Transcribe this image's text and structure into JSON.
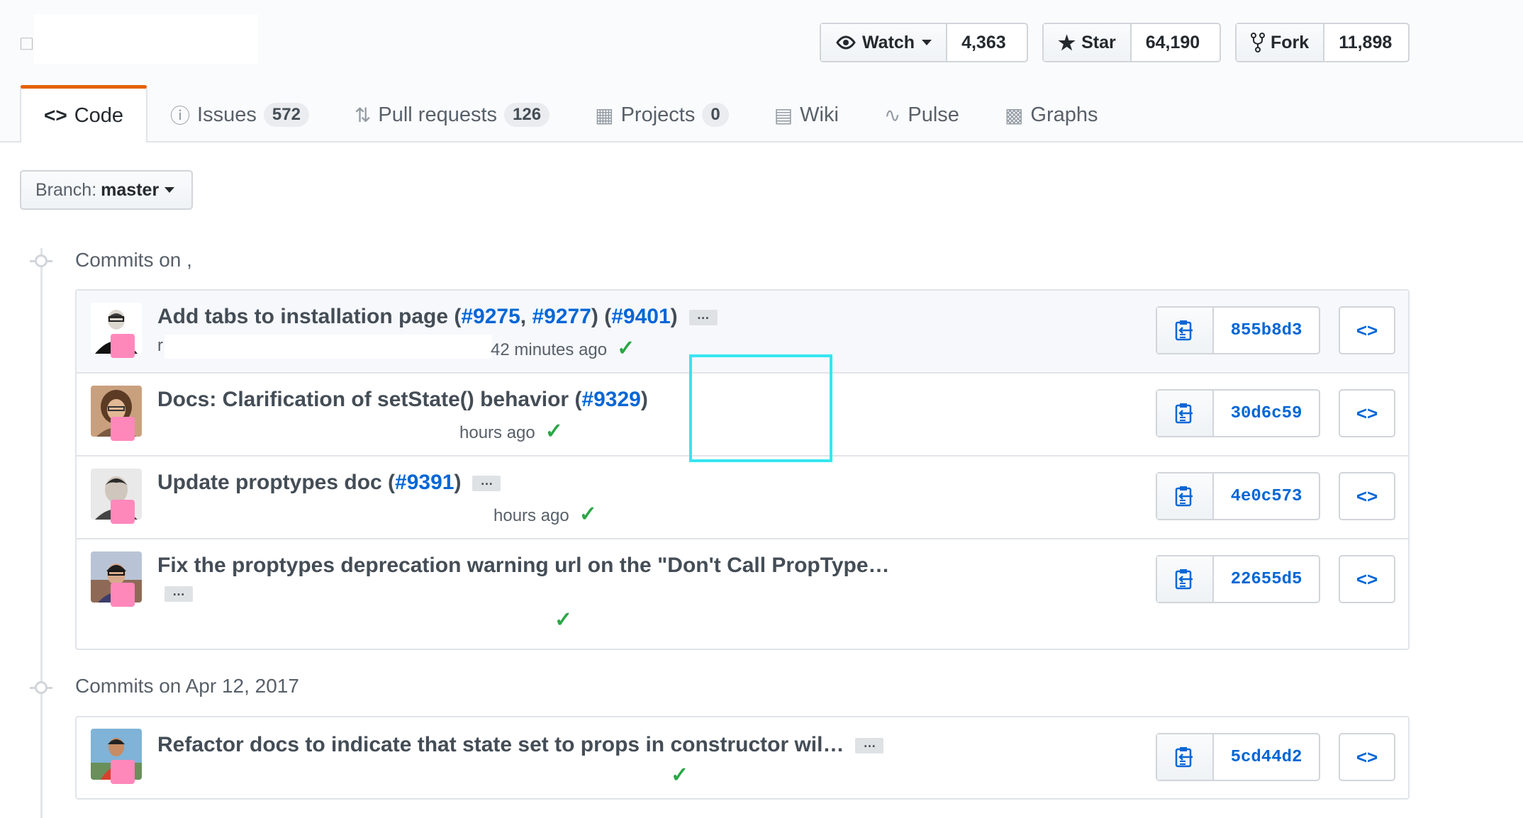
{
  "header": {
    "watch": {
      "label": "Watch",
      "count": "4,363"
    },
    "star": {
      "label": "Star",
      "count": "64,190"
    },
    "fork": {
      "label": "Fork",
      "count": "11,898"
    }
  },
  "tabs": [
    {
      "label": "Code",
      "icon": "code-icon"
    },
    {
      "label": "Issues",
      "count": "572",
      "icon": "issue-icon"
    },
    {
      "label": "Pull requests",
      "count": "126",
      "icon": "pull-request-icon"
    },
    {
      "label": "Projects",
      "count": "0",
      "icon": "project-icon"
    },
    {
      "label": "Wiki",
      "icon": "book-icon"
    },
    {
      "label": "Pulse",
      "icon": "pulse-icon"
    },
    {
      "label": "Graphs",
      "icon": "graph-icon"
    }
  ],
  "branch": {
    "prefix": "Branch:",
    "name": "master"
  },
  "groups": [
    {
      "title": "Commits on ,",
      "commits": [
        {
          "msg_pre": "Add tabs to installation page (",
          "link1": "#9275",
          "sep": ", ",
          "link2": "#9277",
          "msg_mid": ") (",
          "link3": "#9401",
          "msg_post": ")",
          "author_initial": "r",
          "time": "42 minutes ago",
          "sha": "855b8d3"
        },
        {
          "msg_pre": "Docs: Clarification of setState() behavior (",
          "link1": "#9329",
          "msg_post": ")",
          "time": "hours ago",
          "sha": "30d6c59"
        },
        {
          "msg_pre": "Update proptypes doc (",
          "link1": "#9391",
          "msg_post": ")",
          "time": "hours ago",
          "sha": "4e0c573"
        },
        {
          "msg_pre": "Fix the proptypes deprecation warning url on the \"Don't Call PropType…",
          "sha": "22655d5"
        }
      ]
    },
    {
      "title": "Commits on Apr 12, 2017",
      "commits": [
        {
          "msg_pre": "Refactor docs to indicate that state set to props in constructor wil…",
          "sha": "5cd44d2"
        }
      ]
    }
  ],
  "ellipsis": "…",
  "browse_label": "<>",
  "colors": {
    "link": "#0366d6",
    "check": "#28a745",
    "tab_accent": "#e36209",
    "highlight": "#35e6f0"
  }
}
